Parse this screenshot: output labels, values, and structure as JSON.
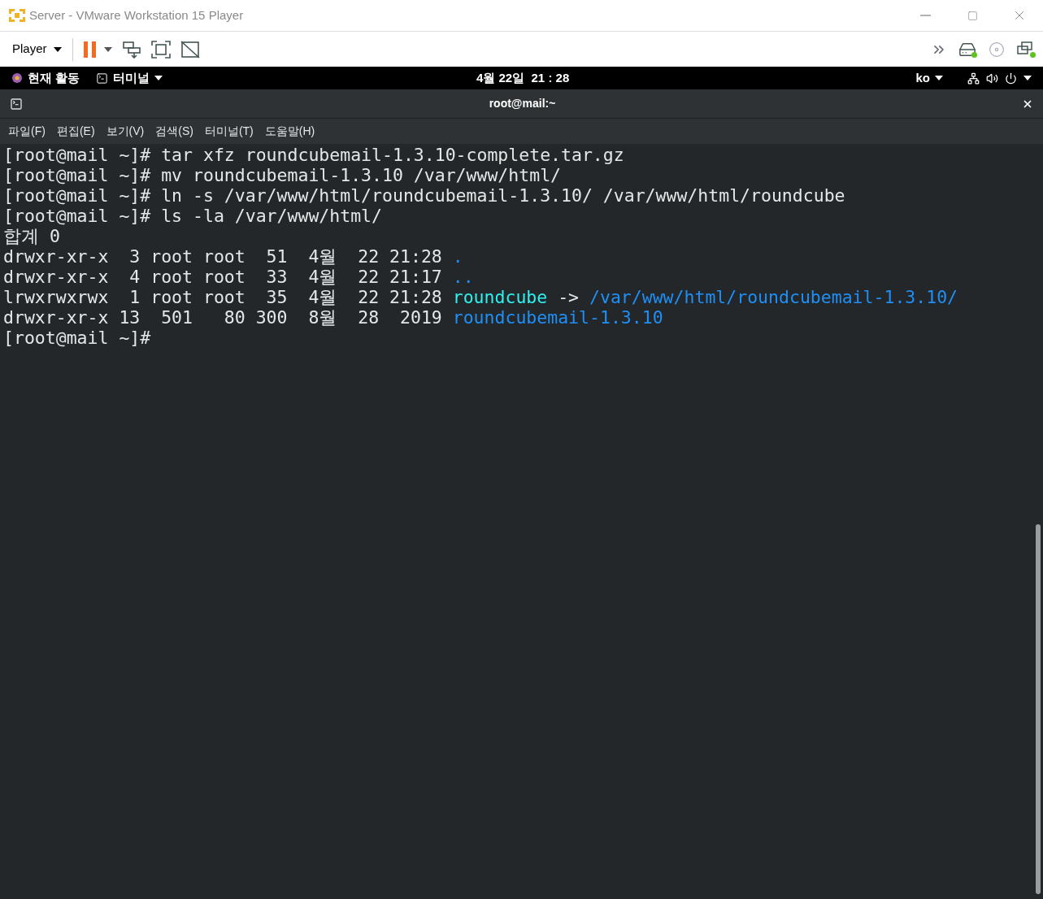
{
  "window": {
    "title": "Server - VMware Workstation 15 Player"
  },
  "toolbar": {
    "player_menu": "Player"
  },
  "top_bar": {
    "activities": "현재 활동",
    "app_menu": "터미널",
    "clock": "4월 22일  21 : 28",
    "input_source": "ko"
  },
  "terminal": {
    "title": "root@mail:~",
    "menu": [
      "파일(F)",
      "편집(E)",
      "보기(V)",
      "검색(S)",
      "터미널(T)",
      "도움말(H)"
    ],
    "lines": [
      [
        {
          "kind": "text",
          "text": "[root@mail ~]# tar xfz roundcubemail-1.3.10-complete.tar.gz"
        }
      ],
      [
        {
          "kind": "text",
          "text": "[root@mail ~]# mv roundcubemail-1.3.10 /var/www/html/"
        }
      ],
      [
        {
          "kind": "text",
          "text": "[root@mail ~]# ln -s /var/www/html/roundcubemail-1.3.10/ /var/www/html/roundcube"
        }
      ],
      [
        {
          "kind": "text",
          "text": "[root@mail ~]# ls -la /var/www/html/"
        }
      ],
      [
        {
          "kind": "text",
          "text": "합계 0"
        }
      ],
      [
        {
          "kind": "text",
          "text": "drwxr-xr-x  3 root root  51  4월  22 21:28 "
        },
        {
          "kind": "directory",
          "text": "."
        }
      ],
      [
        {
          "kind": "text",
          "text": "drwxr-xr-x  4 root root  33  4월  22 21:17 "
        },
        {
          "kind": "directory",
          "text": ".."
        }
      ],
      [
        {
          "kind": "text",
          "text": "lrwxrwxrwx  1 root root  35  4월  22 21:28 "
        },
        {
          "kind": "symlink",
          "text": "roundcube"
        },
        {
          "kind": "text",
          "text": " -> "
        },
        {
          "kind": "directory",
          "text": "/var/www/html/roundcubemail-1.3.10/"
        }
      ],
      [
        {
          "kind": "text",
          "text": "drwxr-xr-x 13  501   80 300  8월  28  2019 "
        },
        {
          "kind": "directory",
          "text": "roundcubemail-1.3.10"
        }
      ],
      [
        {
          "kind": "text",
          "text": "[root@mail ~]#"
        }
      ]
    ]
  }
}
